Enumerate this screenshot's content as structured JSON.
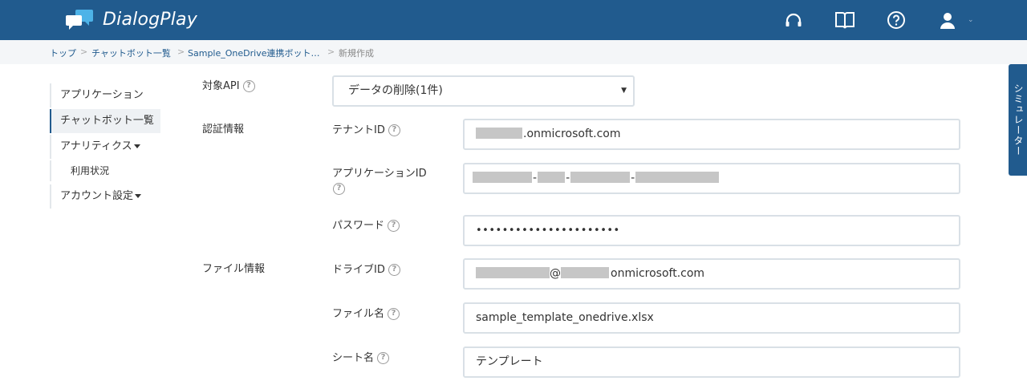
{
  "header": {
    "brand": "DialogPlay",
    "icons": [
      "headset-icon",
      "book-icon",
      "help-circle-icon",
      "user-icon"
    ],
    "colors": {
      "bar": "#215b8e",
      "text": "#ffffff"
    }
  },
  "breadcrumb": {
    "items": [
      "トップ",
      "チャットボット一覧",
      "Sample_OneDrive連携ボット…",
      "新規作成"
    ],
    "separator": ">"
  },
  "sidebar": {
    "items": [
      {
        "label": "アプリケーション"
      },
      {
        "label": "チャットボット一覧",
        "active": true
      },
      {
        "label": "アナリティクス",
        "has_dropdown": true
      },
      {
        "label": "利用状況",
        "sub": true
      },
      {
        "label": "アカウント設定",
        "has_dropdown": true
      }
    ]
  },
  "form": {
    "target_api": {
      "label": "対象API",
      "value": "データの削除(1件)"
    },
    "auth_section": "認証情報",
    "tenant": {
      "label": "テナントID",
      "suffix": ".onmicrosoft.com"
    },
    "app_id": {
      "label": "アプリケーションID"
    },
    "password": {
      "label": "パスワード",
      "value": "••••••••••••••••••••••"
    },
    "file_section": "ファイル情報",
    "drive": {
      "label": "ドライブID",
      "at": "@",
      "suffix": "onmicrosoft.com"
    },
    "file_name": {
      "label": "ファイル名",
      "value": "sample_template_onedrive.xlsx"
    },
    "sheet_name": {
      "label": "シート名",
      "value": "テンプレート"
    }
  },
  "simulator_tab": {
    "label": "シミュレーター"
  },
  "help_glyph": "?"
}
